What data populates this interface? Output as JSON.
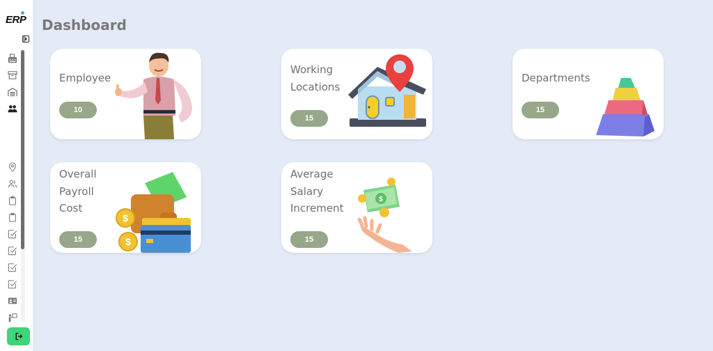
{
  "app": {
    "logo": "ERP"
  },
  "sidebar": {
    "items": [
      {
        "icon": "fax-icon",
        "label": "Fax"
      },
      {
        "icon": "archive-icon",
        "label": "Archive"
      },
      {
        "icon": "warehouse-icon",
        "label": "Warehouse"
      },
      {
        "icon": "users-icon",
        "label": "Users",
        "active": true
      },
      {
        "icon": "location-pin-icon",
        "label": "Location"
      },
      {
        "icon": "people-icon",
        "label": "People"
      },
      {
        "icon": "clipboard-icon",
        "label": "Clipboard"
      },
      {
        "icon": "clipboard-icon",
        "label": "Clipboard 2"
      },
      {
        "icon": "checkbox-icon",
        "label": "Task 1"
      },
      {
        "icon": "checkbox-icon",
        "label": "Task 2"
      },
      {
        "icon": "checkbox-icon",
        "label": "Task 3"
      },
      {
        "icon": "checkbox-icon",
        "label": "Task 4"
      },
      {
        "icon": "id-card-icon",
        "label": "ID Card"
      },
      {
        "icon": "presenter-icon",
        "label": "Presenter"
      }
    ],
    "logout_icon": "logout-icon"
  },
  "header": {
    "title": "Dashboard"
  },
  "cards": [
    {
      "title_lines": [
        "Employee"
      ],
      "value": "10",
      "illustration": "employee-illustration"
    },
    {
      "title_lines": [
        "Working",
        "Locations"
      ],
      "value": "15",
      "illustration": "house-location-illustration"
    },
    {
      "title_lines": [
        "Departments"
      ],
      "value": "15",
      "illustration": "pyramid-illustration"
    },
    {
      "title_lines": [
        "Overall",
        "Payroll",
        "Cost"
      ],
      "value": "15",
      "illustration": "wallet-illustration"
    },
    {
      "title_lines": [
        "Average",
        "Salary",
        "Increment"
      ],
      "value": "15",
      "illustration": "hand-money-illustration"
    }
  ],
  "colors": {
    "background": "#e3ebf7",
    "badge": "#97a789",
    "logout": "#3ed47a"
  }
}
